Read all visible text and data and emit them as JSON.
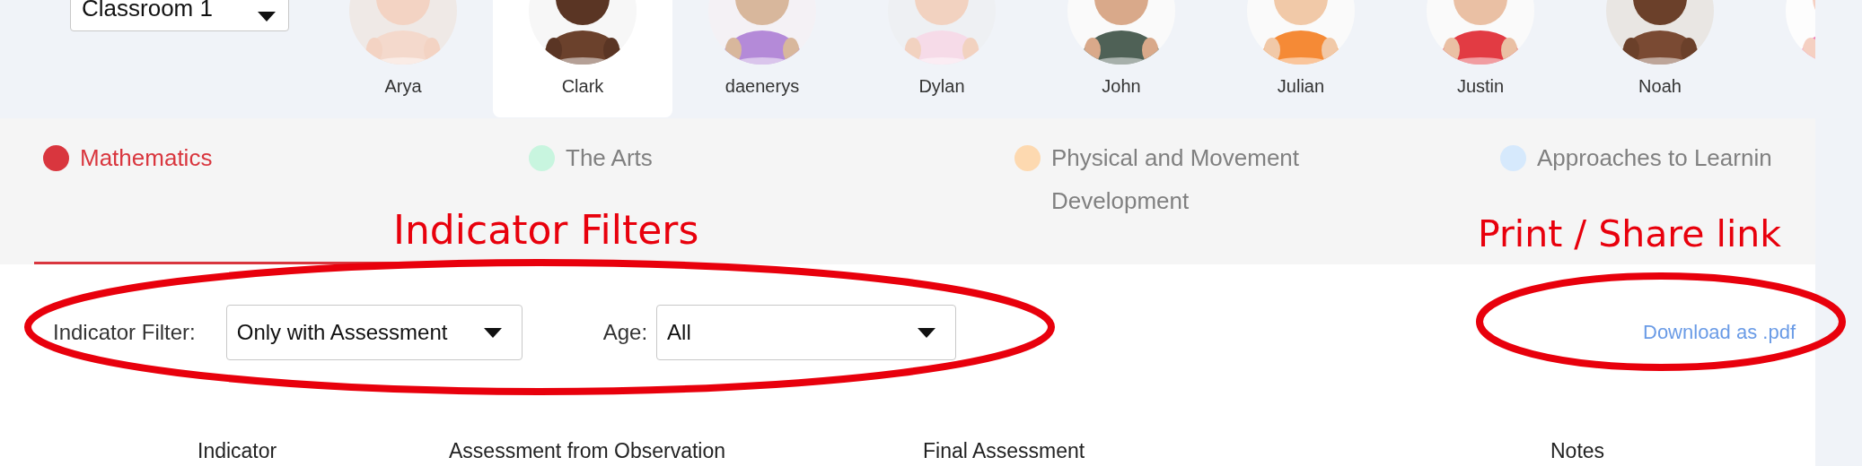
{
  "classroom_select": {
    "value": "Classroom 1"
  },
  "children": [
    {
      "name": "Arya",
      "selected": false
    },
    {
      "name": "Clark",
      "selected": true
    },
    {
      "name": "daenerys",
      "selected": false
    },
    {
      "name": "Dylan",
      "selected": false
    },
    {
      "name": "John",
      "selected": false
    },
    {
      "name": "Julian",
      "selected": false
    },
    {
      "name": "Justin",
      "selected": false
    },
    {
      "name": "Noah",
      "selected": false
    },
    {
      "selected": false
    }
  ],
  "subjects": [
    {
      "label": "Mathematics",
      "selected": true,
      "color": "#d9363e"
    },
    {
      "label": "The Arts",
      "selected": false,
      "color": "#c8f5df"
    },
    {
      "label": "Physical and Movement Development",
      "selected": false,
      "color": "#fdd9b0"
    },
    {
      "label": "Approaches to Learnin",
      "selected": false,
      "color": "#d6e9fc"
    }
  ],
  "filters": [
    {
      "label": "Indicator Filter:",
      "value": "Only with Assessment"
    },
    {
      "label": "Age:",
      "value": "All"
    }
  ],
  "download_link": "Download as .pdf",
  "annotations": [
    {
      "text": "Indicator Filters"
    },
    {
      "text": "Print / Share link"
    }
  ],
  "table": {
    "columns": [
      "Indicator",
      "Assessment from Observation",
      "Final Assessment",
      "Notes"
    ]
  }
}
